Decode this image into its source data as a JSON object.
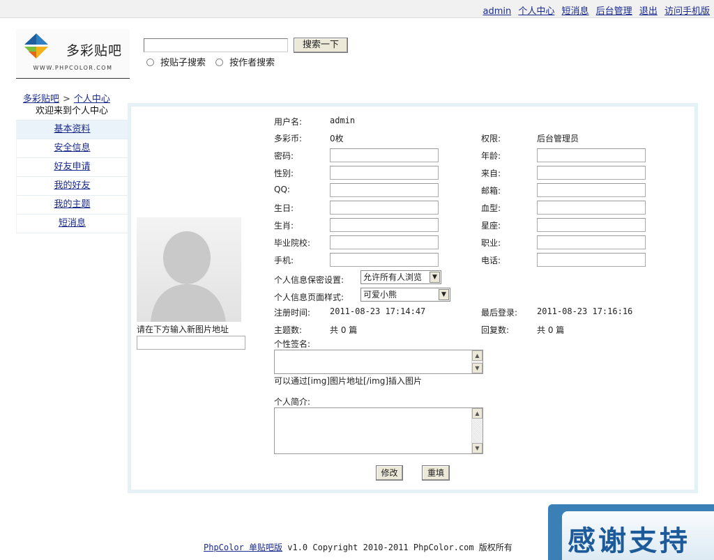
{
  "topbar": {
    "links": [
      "admin",
      "个人中心",
      "短消息",
      "后台管理",
      "退出",
      "访问手机版"
    ]
  },
  "logo": {
    "name": "多彩贴吧",
    "url": "WWW.PHPCOLOR.COM"
  },
  "search": {
    "button": "搜索一下",
    "input_value": "",
    "radio_post": "按贴子搜索",
    "radio_author": "按作者搜索"
  },
  "breadcrumb": {
    "home": "多彩贴吧",
    "sep": ">",
    "current": "个人中心"
  },
  "sidebar": {
    "header": "欢迎来到个人中心",
    "items": [
      "基本资料",
      "安全信息",
      "好友申请",
      "我的好友",
      "我的主题",
      "短消息"
    ],
    "active_index": 0
  },
  "avatar": {
    "label": "请在下方输入新图片地址"
  },
  "profile": {
    "username_label": "用户名:",
    "username": "admin",
    "coins_label": "多彩币:",
    "coins": "0枚",
    "permission_label": "权限:",
    "permission": "后台管理员",
    "password_label": "密码:",
    "age_label": "年龄:",
    "gender_label": "性别:",
    "from_label": "来自:",
    "qq_label": "QQ:",
    "email_label": "邮箱:",
    "birthday_label": "生日:",
    "blood_label": "血型:",
    "zodiac_label": "生肖:",
    "constellation_label": "星座:",
    "school_label": "毕业院校:",
    "job_label": "职业:",
    "mobile_label": "手机:",
    "phone_label": "电话:",
    "privacy_label": "个人信息保密设置:",
    "privacy_value": "允许所有人浏览",
    "style_label": "个人信息页面样式:",
    "style_value": "可爱小熊",
    "register_label": "注册时间:",
    "register_time": "2011-08-23 17:14:47",
    "last_login_label": "最后登录:",
    "last_login_time": "2011-08-23 17:16:16",
    "topics_label": "主题数:",
    "topics_value": "共 0 篇",
    "replies_label": "回复数:",
    "replies_value": "共 0 篇",
    "signature_label": "个性签名:",
    "signature_hint": "可以通过[img]图片地址[/img]插入图片",
    "intro_label": "个人简介:",
    "submit": "修改",
    "reset": "重填"
  },
  "footer": {
    "link": "PhpColor 单贴吧版",
    "text": " v1.0 Copyright 2010-2011 PhpColor.com 版权所有"
  },
  "banner": {
    "text": "感谢支持"
  }
}
